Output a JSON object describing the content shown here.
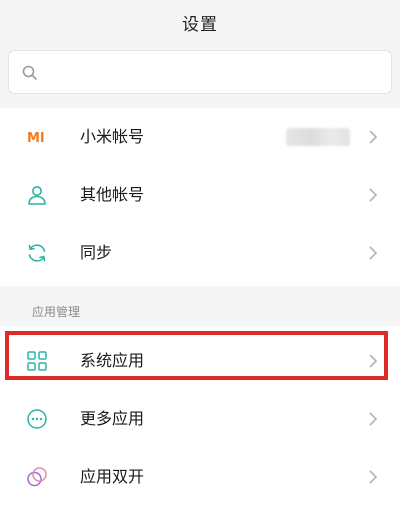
{
  "header": {
    "title": "设置"
  },
  "search": {
    "value": "",
    "placeholder": ""
  },
  "accounts": {
    "items": [
      {
        "label": "小米帐号",
        "icon": "mi-logo-icon"
      },
      {
        "label": "其他帐号",
        "icon": "person-icon"
      },
      {
        "label": "同步",
        "icon": "sync-icon"
      }
    ]
  },
  "apps": {
    "section_title": "应用管理",
    "items": [
      {
        "label": "系统应用",
        "icon": "grid-icon"
      },
      {
        "label": "更多应用",
        "icon": "more-dots-icon"
      },
      {
        "label": "应用双开",
        "icon": "dual-apps-icon"
      }
    ]
  },
  "colors": {
    "mi_orange": "#f47b20",
    "teal": "#2bb5a4",
    "highlight": "#e02a2a"
  }
}
